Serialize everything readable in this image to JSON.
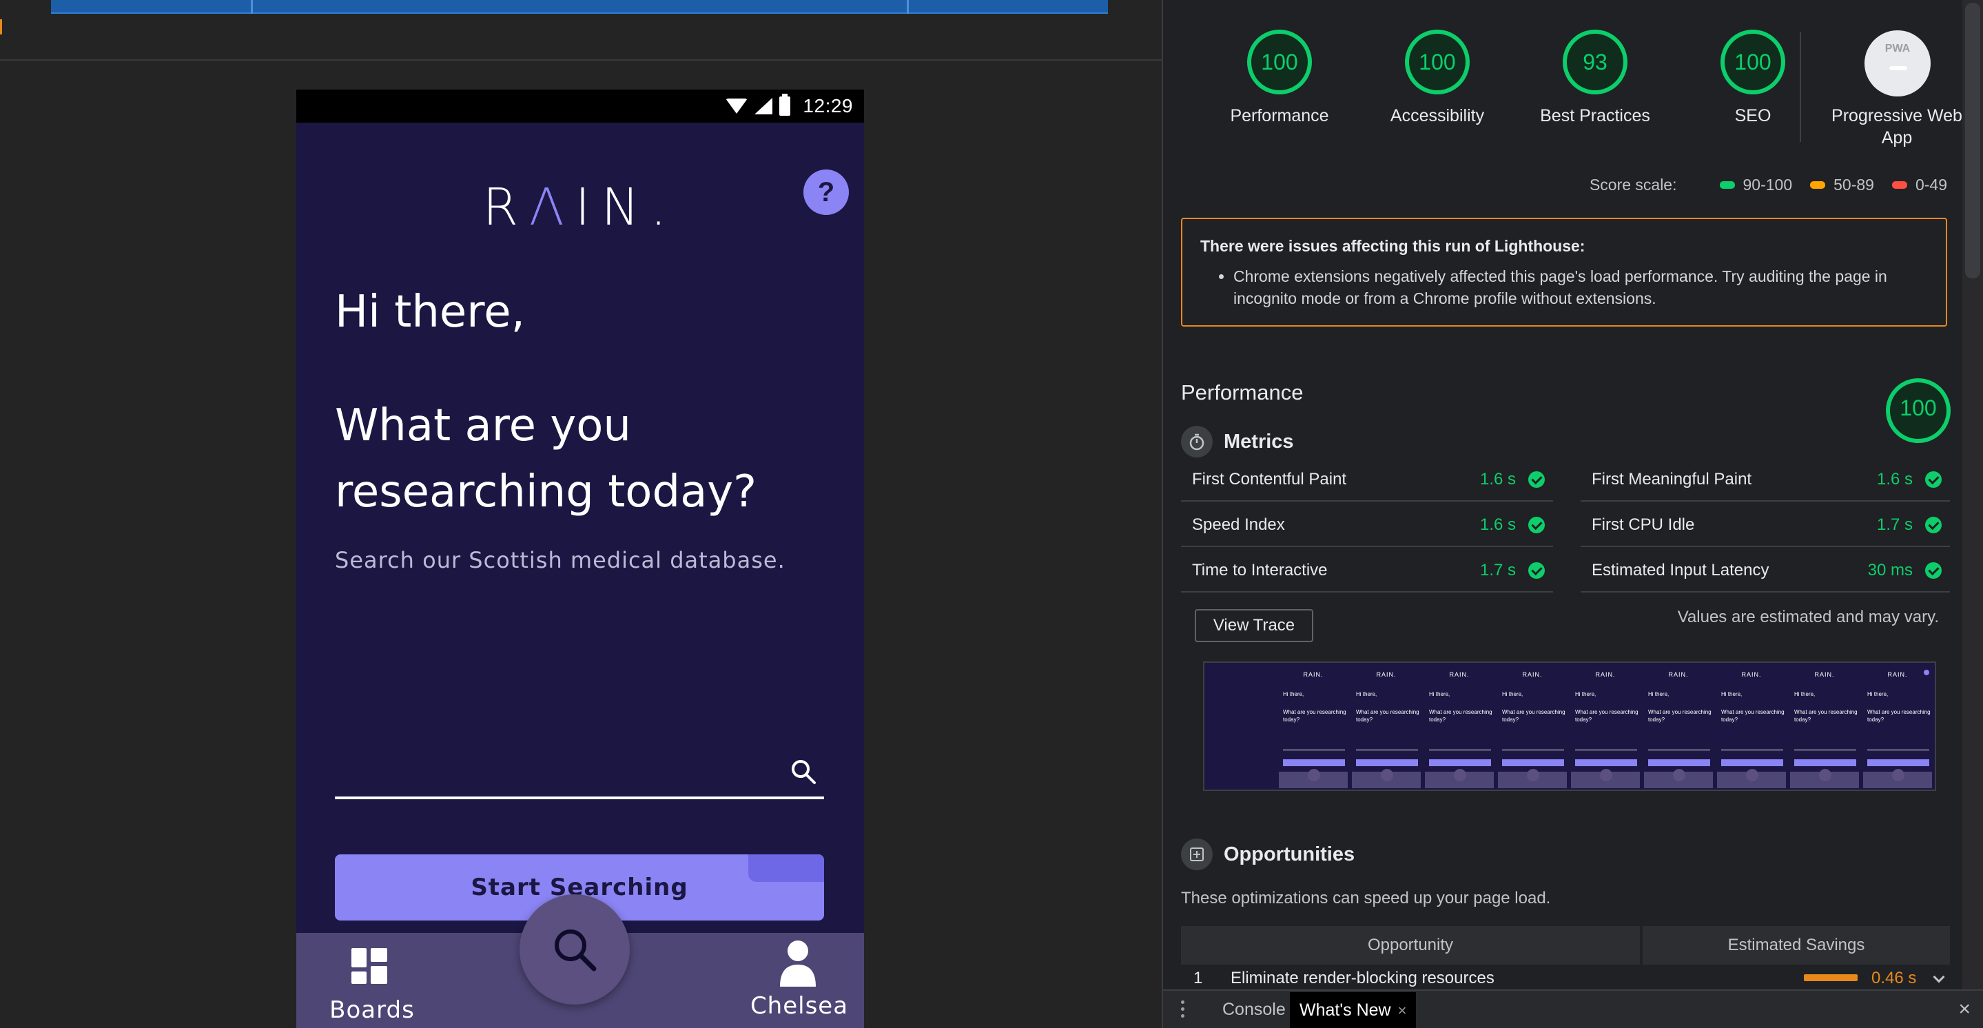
{
  "app": {
    "hero": {
      "logo_left": "R",
      "logo_triangle": "Λ",
      "logo_right": "IN",
      "logo_dot": ".",
      "help_label": "?",
      "greeting": "Hi there,",
      "question": "What are you researching today?",
      "subtitle": "Search our Scottish medical database.",
      "search_placeholder": "",
      "start_button": "Start Searching"
    },
    "status_bar": {
      "time": "12:29"
    },
    "bottom_nav": {
      "boards_label": "Boards",
      "profile_label": "Chelsea"
    },
    "colors": {
      "background": "#1b1642",
      "accent": "#8b84f4",
      "nav": "#4e4675"
    },
    "icons": [
      "wifi-icon",
      "signal-icon",
      "battery-icon",
      "help-icon",
      "search-icon",
      "boards-icon",
      "person-icon"
    ]
  },
  "lighthouse": {
    "gauges": [
      {
        "score": "100",
        "label": "Performance"
      },
      {
        "score": "100",
        "label": "Accessibility"
      },
      {
        "score": "93",
        "label": "Best Practices"
      },
      {
        "score": "100",
        "label": "SEO"
      }
    ],
    "pwa": {
      "badge_text": "PWA",
      "label": "Progressive Web App"
    },
    "score_scale": {
      "title": "Score scale:",
      "ranges": [
        {
          "label": "90-100",
          "color": "#0cce6b"
        },
        {
          "label": "50-89",
          "color": "#ffa400"
        },
        {
          "label": "0-49",
          "color": "#ff4e42"
        }
      ]
    },
    "warning": {
      "title": "There were issues affecting this run of Lighthouse:",
      "items": [
        "Chrome extensions negatively affected this page's load performance. Try auditing the page in incognito mode or from a Chrome profile without extensions."
      ]
    },
    "performance": {
      "title": "Performance",
      "score": "100",
      "metrics_title": "Metrics",
      "metrics": [
        {
          "name": "First Contentful Paint",
          "value": "1.6 s"
        },
        {
          "name": "First Meaningful Paint",
          "value": "1.6 s"
        },
        {
          "name": "Speed Index",
          "value": "1.6 s"
        },
        {
          "name": "First CPU Idle",
          "value": "1.7 s"
        },
        {
          "name": "Time to Interactive",
          "value": "1.7 s"
        },
        {
          "name": "Estimated Input Latency",
          "value": "30 ms"
        }
      ],
      "view_trace": "View Trace",
      "estimated_note": "Values are estimated and may vary.",
      "filmstrip": {
        "logo": "RAIN.",
        "greeting": "Hi there,",
        "question": "What are you researching today?"
      }
    },
    "opportunities": {
      "title": "Opportunities",
      "description": "These optimizations can speed up your page load.",
      "columns": [
        "Opportunity",
        "Estimated Savings"
      ],
      "rows": [
        {
          "index": "1",
          "name": "Eliminate render-blocking resources",
          "savings": "0.46 s"
        }
      ]
    }
  },
  "drawer": {
    "tabs": [
      {
        "label": "Console"
      },
      {
        "label": "What's New"
      }
    ],
    "tab_close": "×",
    "close": "×"
  }
}
